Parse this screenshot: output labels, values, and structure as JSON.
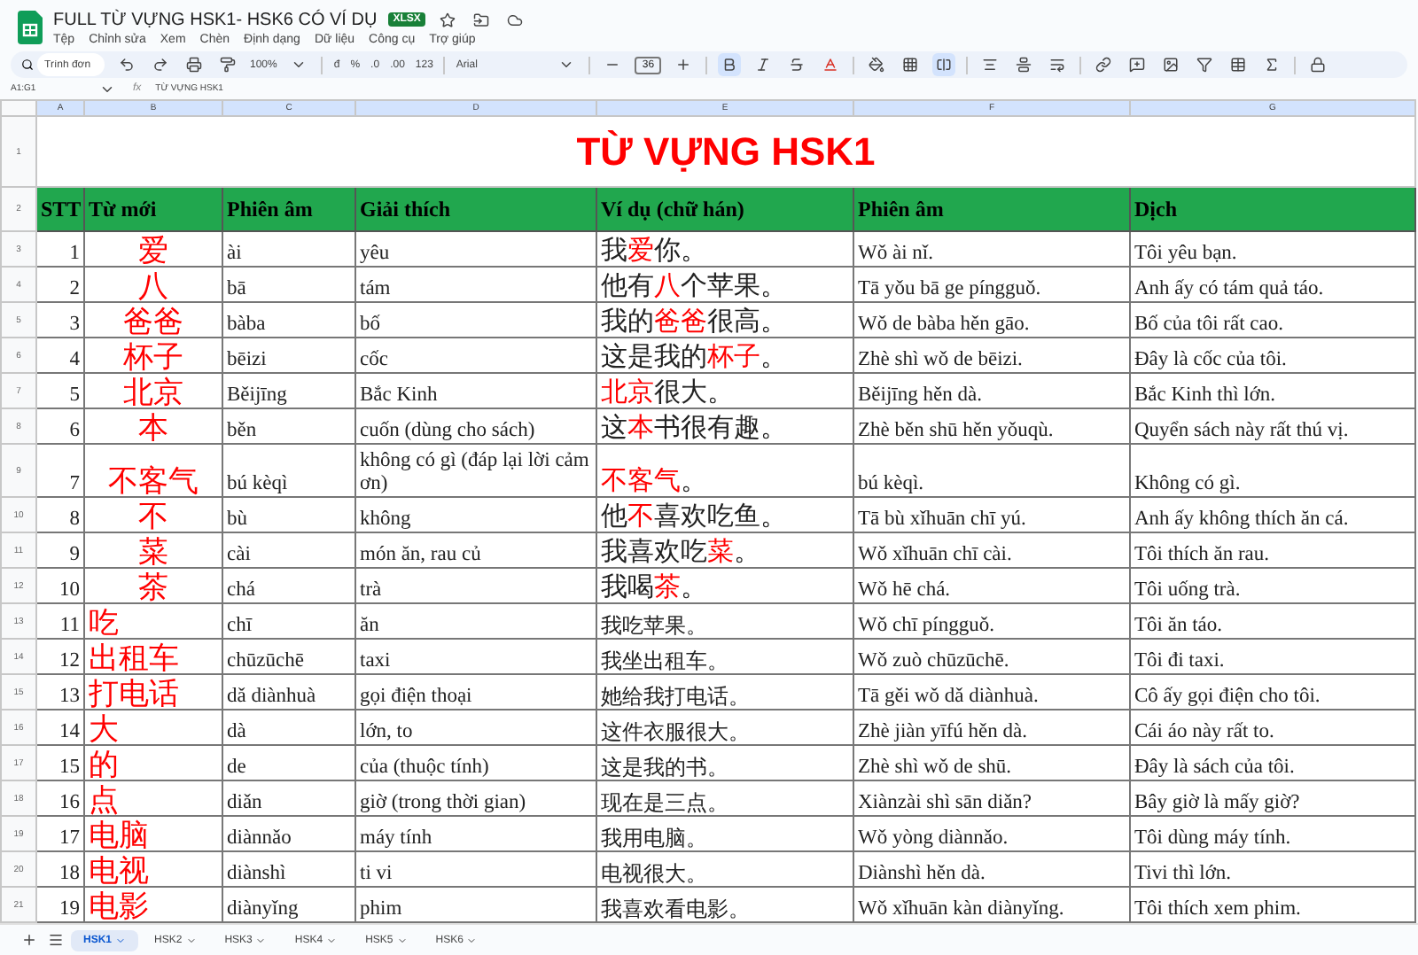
{
  "window": {
    "title": "FULL TỪ VỰNG HSK1- HSK6 CÓ VÍ DỤ",
    "badge": "XLSX"
  },
  "menu": [
    "Tệp",
    "Chỉnh sửa",
    "Xem",
    "Chèn",
    "Định dạng",
    "Dữ liệu",
    "Công cụ",
    "Trợ giúp"
  ],
  "toolbar": {
    "search": {
      "placeholder": "Trình đơn"
    },
    "currency": "đ",
    "percent": "%",
    "decimal_decrease": ".0",
    "decimal_increase": ".00",
    "number_format": "123",
    "zoom": "100%",
    "font": "Arial",
    "font_size": "36",
    "bold": true,
    "merge": true
  },
  "formula_bar": {
    "cell_ref": "A1:G1",
    "fx": "fx",
    "value": "TỪ VỰNG HSK1"
  },
  "column_letters": [
    "A",
    "B",
    "C",
    "D",
    "E",
    "F",
    "G"
  ],
  "sheet": {
    "title_row": "1",
    "title": "TỪ VỰNG HSK1",
    "header_row": "2",
    "headers": [
      "STT",
      "Từ mới",
      "Phiên âm",
      "Giải thích",
      "Ví dụ (chữ hán)",
      "Phiên âm",
      "Dịch"
    ],
    "rows": [
      {
        "row": "3",
        "kind": "styled",
        "n": "1",
        "word": "爱",
        "pinyin": "ài",
        "meaning": "yêu",
        "example": "我**爱**你。",
        "example_pinyin": "Wǒ ài nǐ.",
        "translation": "Tôi yêu bạn."
      },
      {
        "row": "4",
        "kind": "styled",
        "n": "2",
        "word": "八",
        "pinyin": "bā",
        "meaning": "tám",
        "example": "他有**八**个苹果。",
        "example_pinyin": "Tā yǒu bā ge píngguǒ.",
        "translation": "Anh ấy có tám quả táo."
      },
      {
        "row": "5",
        "kind": "styled",
        "n": "3",
        "word": "爸爸",
        "pinyin": "bàba",
        "meaning": "bố",
        "example": "我的**爸爸**很高。",
        "example_pinyin": "Wǒ de bàba hěn gāo.",
        "translation": "Bố của tôi rất cao."
      },
      {
        "row": "6",
        "kind": "styled",
        "n": "4",
        "word": "杯子",
        "pinyin": "bēizi",
        "meaning": "cốc",
        "example": "这是我的**杯子**。",
        "example_pinyin": "Zhè shì wǒ de bēizi.",
        "translation": "Đây là cốc của tôi."
      },
      {
        "row": "7",
        "kind": "styled",
        "n": "5",
        "word": "北京",
        "pinyin": "Běijīng",
        "meaning": "Bắc Kinh",
        "example": "**北京**很大。",
        "example_pinyin": "Běijīng hěn dà.",
        "translation": "Bắc Kinh thì lớn."
      },
      {
        "row": "8",
        "kind": "styled",
        "n": "6",
        "word": "本",
        "pinyin": "běn",
        "meaning": "cuốn (dùng cho sách)",
        "example": "这**本**书很有趣。",
        "example_pinyin": "Zhè běn shū hěn yǒuqù.",
        "translation": "Quyển sách này rất thú vị."
      },
      {
        "row": "9",
        "kind": "styled",
        "n": "7",
        "word": "不客气",
        "pinyin": "bú kèqì",
        "meaning": "không có gì (đáp lại lời cảm ơn)",
        "example": "**不客气**。",
        "example_pinyin": "bú kèqì.",
        "translation": "Không có gì."
      },
      {
        "row": "10",
        "kind": "styled",
        "n": "8",
        "word": "不",
        "pinyin": "bù",
        "meaning": "không",
        "example": "他**不**喜欢吃鱼。",
        "example_pinyin": "Tā bù xǐhuān chī yú.",
        "translation": "Anh ấy không thích ăn cá."
      },
      {
        "row": "11",
        "kind": "styled",
        "n": "9",
        "word": "菜",
        "pinyin": "cài",
        "meaning": "món ăn, rau củ",
        "example": "我喜欢吃**菜**。",
        "example_pinyin": "Wǒ xǐhuān chī cài.",
        "translation": "Tôi thích ăn rau."
      },
      {
        "row": "12",
        "kind": "styled",
        "n": "10",
        "word": "茶",
        "pinyin": "chá",
        "meaning": "trà",
        "example": "我喝**茶**。",
        "example_pinyin": "Wǒ hē chá.",
        "translation": "Tôi uống trà."
      },
      {
        "row": "13",
        "kind": "plain",
        "n": "11",
        "word": "吃",
        "pinyin": "chī",
        "meaning": "ăn",
        "example": "我吃苹果。",
        "example_pinyin": "Wǒ chī píngguǒ.",
        "translation": "Tôi ăn táo."
      },
      {
        "row": "14",
        "kind": "plain",
        "n": "12",
        "word": "出租车",
        "pinyin": "chūzūchē",
        "meaning": "taxi",
        "example": "我坐出租车。",
        "example_pinyin": "Wǒ zuò chūzūchē.",
        "translation": "Tôi đi taxi."
      },
      {
        "row": "15",
        "kind": "plain",
        "n": "13",
        "word": "打电话",
        "pinyin": "dǎ diànhuà",
        "meaning": "gọi điện thoại",
        "example": "她给我打电话。",
        "example_pinyin": "Tā gěi wǒ dǎ diànhuà.",
        "translation": "Cô ấy gọi điện cho tôi."
      },
      {
        "row": "16",
        "kind": "plain",
        "n": "14",
        "word": "大",
        "pinyin": "dà",
        "meaning": "lớn, to",
        "example": "这件衣服很大。",
        "example_pinyin": "Zhè jiàn yīfú hěn dà.",
        "translation": "Cái áo này rất to."
      },
      {
        "row": "17",
        "kind": "plain",
        "n": "15",
        "word": "的",
        "pinyin": "de",
        "meaning": "của (thuộc tính)",
        "example": "这是我的书。",
        "example_pinyin": "Zhè shì wǒ de shū.",
        "translation": "Đây là sách của tôi."
      },
      {
        "row": "18",
        "kind": "plain",
        "n": "16",
        "word": "点",
        "pinyin": "diǎn",
        "meaning": "giờ (trong thời gian)",
        "example": "现在是三点。",
        "example_pinyin": "Xiànzài shì sān diǎn?",
        "translation": "Bây giờ là mấy giờ?"
      },
      {
        "row": "19",
        "kind": "plain",
        "n": "17",
        "word": "电脑",
        "pinyin": "diànnǎo",
        "meaning": "máy tính",
        "example": "我用电脑。",
        "example_pinyin": "Wǒ yòng diànnǎo.",
        "translation": "Tôi dùng máy tính."
      },
      {
        "row": "20",
        "kind": "plain",
        "n": "18",
        "word": "电视",
        "pinyin": "diànshì",
        "meaning": "ti vi",
        "example": "电视很大。",
        "example_pinyin": "Diànshì hěn dà.",
        "translation": "Tivi thì lớn."
      },
      {
        "row": "21",
        "kind": "plain",
        "n": "19",
        "word": "电影",
        "pinyin": "diànyǐng",
        "meaning": "phim",
        "example": "我喜欢看电影。",
        "example_pinyin": "Wǒ xǐhuān kàn diànyǐng.",
        "translation": "Tôi thích xem phim."
      }
    ]
  },
  "sheet_tabs": [
    {
      "label": "HSK1",
      "selected": true
    },
    {
      "label": "HSK2",
      "selected": false
    },
    {
      "label": "HSK3",
      "selected": false
    },
    {
      "label": "HSK4",
      "selected": false
    },
    {
      "label": "HSK5",
      "selected": false
    },
    {
      "label": "HSK6",
      "selected": false
    }
  ]
}
